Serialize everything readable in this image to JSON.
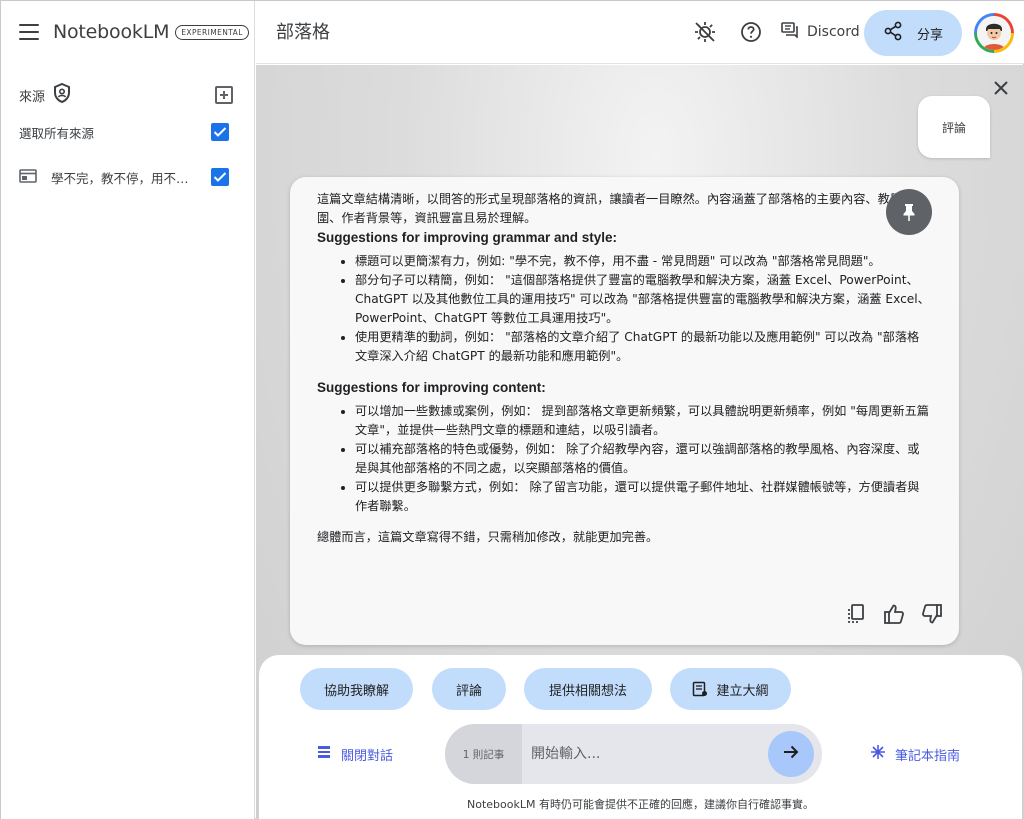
{
  "app": {
    "name": "NotebookLM",
    "badge": "EXPERIMENTAL"
  },
  "header": {
    "notebook_title": "部落格",
    "discord_label": "Discord",
    "share_label": "分享"
  },
  "sidebar": {
    "sources_title": "來源",
    "select_all_label": "選取所有來源",
    "sources": [
      {
        "label": "學不完，教不停，用不盡 - 常見問題",
        "checked": true
      }
    ]
  },
  "conversation": {
    "user_bubble": "評論",
    "response": {
      "intro": "這篇文章結構清晰，以問答的形式呈現部落格的資訊，讓讀者一目瞭然。內容涵蓋了部落格的主要內容、教學範圍、作者背景等，資訊豐富且易於理解。",
      "sections": [
        {
          "heading": "Suggestions for improving grammar and style:",
          "items": [
            "標題可以更簡潔有力，例如: \"學不完，教不停，用不盡 - 常見問題\" 可以改為 \"部落格常見問題\"。",
            "部分句子可以精簡，例如： \"這個部落格提供了豐富的電腦教學和解決方案，涵蓋 Excel、PowerPoint、ChatGPT 以及其他數位工具的運用技巧\" 可以改為 \"部落格提供豐富的電腦教學和解決方案，涵蓋 Excel、PowerPoint、ChatGPT 等數位工具運用技巧\"。",
            "使用更精準的動詞，例如： \"部落格的文章介紹了 ChatGPT 的最新功能以及應用範例\" 可以改為 \"部落格文章深入介紹 ChatGPT 的最新功能和應用範例\"。"
          ]
        },
        {
          "heading": "Suggestions for improving content:",
          "items": [
            "可以增加一些數據或案例，例如： 提到部落格文章更新頻繁，可以具體說明更新頻率，例如 \"每周更新五篇文章\"，並提供一些熱門文章的標題和連結，以吸引讀者。",
            "可以補充部落格的特色或優勢，例如： 除了介紹教學內容，還可以強調部落格的教學風格、內容深度、或是與其他部落格的不同之處，以突顯部落格的價值。",
            "可以提供更多聯繫方式，例如： 除了留言功能，還可以提供電子郵件地址、社群媒體帳號等，方便讀者與作者聯繫。"
          ]
        }
      ],
      "conclusion": "總體而言，這篇文章寫得不錯，只需稍加修改，就能更加完善。"
    }
  },
  "composer": {
    "chips": [
      "協助我瞭解",
      "評論",
      "提供相關想法",
      "建立大綱"
    ],
    "close_chat_label": "關閉對話",
    "notes_count": "1 則記事",
    "input_placeholder": "開始輸入...",
    "guide_label": "筆記本指南",
    "disclaimer": "NotebookLM 有時仍可能會提供不正確的回應，建議你自行確認事實。"
  },
  "colors": {
    "accent": "#1a73e8",
    "chip_bg": "#c2dcfb",
    "link": "#4a5be0"
  },
  "icons": {
    "menu": "menu-icon",
    "shield": "shield-icon",
    "add_source": "add-source-icon",
    "theme": "brightness-icon",
    "help": "help-icon",
    "discord": "discord-icon",
    "share": "share-icon",
    "close": "close-icon",
    "pin": "pin-icon",
    "copy": "copy-icon",
    "thumbs_up": "thumbs-up-icon",
    "thumbs_down": "thumbs-down-icon",
    "outline": "outline-doc-icon",
    "close_chat": "close-chat-icon",
    "send": "arrow-right-icon",
    "guide": "sparkle-icon"
  }
}
